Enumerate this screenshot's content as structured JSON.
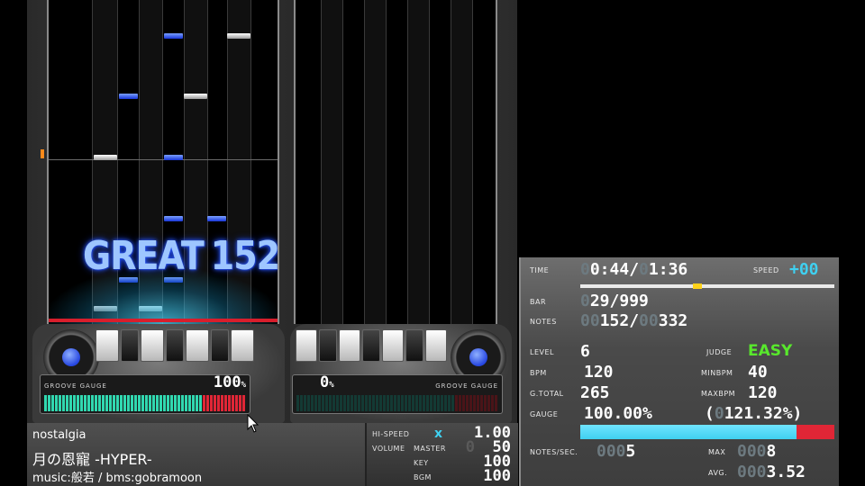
{
  "player1": {
    "judge_text": "GREAT",
    "combo": "152",
    "gauge_label": "GROOVE GAUGE",
    "gauge_percent": "100",
    "gauge_unit": "%",
    "gauge_value": 1.0
  },
  "player2": {
    "gauge_label": "GROOVE GAUGE",
    "gauge_percent": "0",
    "gauge_unit": "%",
    "gauge_value": 0.0
  },
  "song": {
    "genre": "nostalgia",
    "title": "月の恩寵 -HYPER-",
    "credits": "music:般若 / bms:gobramoon"
  },
  "options": {
    "hispeed_label": "HI-SPEED",
    "hispeed_x": "x",
    "hispeed_value": "1.00",
    "volume_label": "VOLUME",
    "master_label": "MASTER",
    "master_value": "50",
    "master_ghost": "0",
    "key_label": "KEY",
    "key_value": "100",
    "bgm_label": "BGM",
    "bgm_value": "100"
  },
  "stats": {
    "time_label": "TIME",
    "time_current_ghost": "0",
    "time_current": "0:44",
    "time_sep": "/",
    "time_total_ghost": "0",
    "time_total": "1:36",
    "time_progress": 0.46,
    "speed_label": "SPEED",
    "speed_value": "+00",
    "bar_label": "BAR",
    "bar_ghost": "0",
    "bar_value": "29/999",
    "notes_label": "NOTES",
    "notes_ghost1": "00",
    "notes_current": "152/",
    "notes_ghost2": "00",
    "notes_total": "332",
    "level_label": "LEVEL",
    "level_value": "6",
    "judge_label": "JUDGE",
    "judge_value": "EASY",
    "bpm_label": "BPM",
    "bpm_value": "120",
    "minbpm_label": "MINBPM",
    "minbpm_value": "40",
    "gtotal_label": "G.TOTAL",
    "gtotal_value": "265",
    "maxbpm_label": "MAXBPM",
    "maxbpm_value": "120",
    "gauge_label": "GAUGE",
    "gauge_value": "100.00%",
    "gauge_paren": "(",
    "gauge_ghost": "0",
    "gauge_extra": "121.32%)",
    "gauge_fill": 0.85,
    "nps_label": "NOTES/SEC.",
    "nps_ghost": "000",
    "nps_value": "5",
    "max_label": "MAX",
    "max_ghost": "000",
    "max_value": "8",
    "avg_label": "AVG.",
    "avg_ghost": "000",
    "avg_value": "3.52"
  },
  "colors": {
    "gauge_green": "#31d8b0",
    "gauge_red": "#e02636",
    "stat_cyan": "#3fd0f0",
    "easy_green": "#58e82c",
    "note_blue": "#1836d8"
  }
}
